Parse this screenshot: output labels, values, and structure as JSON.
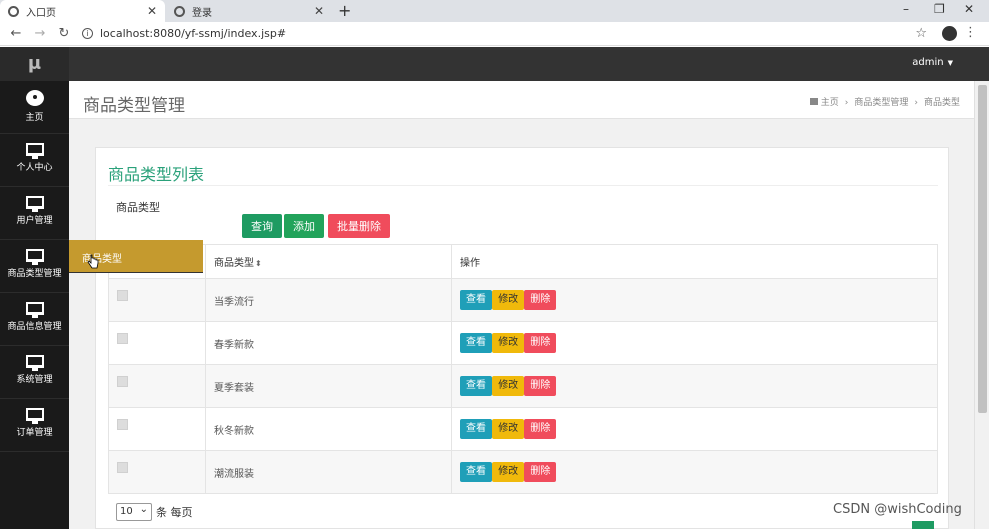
{
  "browser": {
    "tabs": [
      {
        "title": "入口页",
        "active": true
      },
      {
        "title": "登录",
        "active": false
      }
    ],
    "url": "localhost:8080/yf-ssmj/index.jsp#"
  },
  "app": {
    "logo": "μ",
    "user": "admin"
  },
  "sidebar": {
    "items": [
      {
        "label": "主页",
        "icon": "dashboard-icon"
      },
      {
        "label": "个人中心",
        "icon": "monitor-icon"
      },
      {
        "label": "用户管理",
        "icon": "monitor-icon"
      },
      {
        "label": "商品类型管理",
        "icon": "monitor-icon"
      },
      {
        "label": "商品信息管理",
        "icon": "monitor-icon"
      },
      {
        "label": "系统管理",
        "icon": "monitor-icon"
      },
      {
        "label": "订单管理",
        "icon": "monitor-icon"
      }
    ]
  },
  "page": {
    "title": "商品类型管理",
    "breadcrumb": [
      "主页",
      "商品类型管理",
      "商品类型"
    ]
  },
  "panel": {
    "title": "商品类型列表",
    "search_label": "商品类型",
    "buttons": {
      "query": "查询",
      "add": "添加",
      "bulk_delete": "批量删除"
    }
  },
  "table": {
    "headers": [
      "商品类型",
      "操作"
    ],
    "rows": [
      "当季流行",
      "春季新款",
      "夏季套装",
      "秋冬新款",
      "潮流服装"
    ],
    "actions": {
      "view": "查看",
      "edit": "修改",
      "delete": "删除"
    }
  },
  "pagination": {
    "page_size": "10",
    "suffix": "条 每页"
  },
  "drag_tooltip": "商品类型",
  "watermark": "CSDN @wishCoding",
  "colors": {
    "accent_green": "#2aa17a",
    "sidebar_bg": "#1a1a1a",
    "header_bg": "#333333",
    "tooltip": "#c59a2e"
  }
}
